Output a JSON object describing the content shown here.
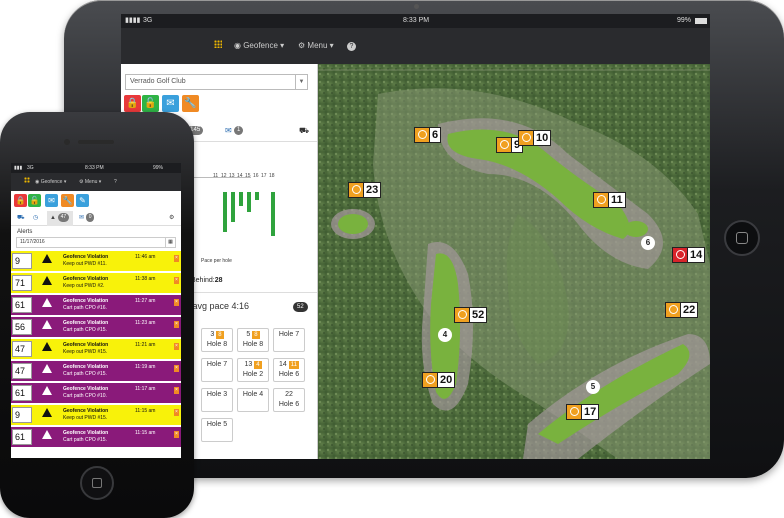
{
  "tablet": {
    "status": {
      "signal": "3G",
      "time": "8:33 PM",
      "battery": "99%"
    },
    "nav": {
      "geofence": "Geofence",
      "menu": "Menu",
      "help": "?"
    },
    "course_select": "Verrado Golf Club",
    "tabs": {
      "alerts_count": "145",
      "messages_count": "1"
    },
    "chart_labels": [
      "11",
      "12",
      "13",
      "14",
      "15",
      "16",
      "17",
      "18"
    ],
    "pace_caption": "Pace per hole",
    "behind_label": "Behind:",
    "behind_value": "28",
    "avg_pace": "- avg pace 4:16",
    "avg_count": "52",
    "holes": [
      {
        "cart": "3",
        "count": "8",
        "hole": "Hole 8"
      },
      {
        "cart": "5",
        "count": "8",
        "hole": "Hole 8"
      },
      {
        "cart": "",
        "count": "",
        "hole": "Hole 7"
      },
      {
        "cart": "",
        "count": "",
        "hole": "Hole 7"
      },
      {
        "cart": "13",
        "count": "4",
        "hole": "Hole 2"
      },
      {
        "cart": "14",
        "count": "11",
        "hole": "Hole 6"
      },
      {
        "cart": "",
        "count": "",
        "hole": "Hole 3"
      },
      {
        "cart": "",
        "count": "",
        "hole": "Hole 4"
      },
      {
        "cart": "22",
        "count": "",
        "hole": "Hole 6"
      },
      {
        "cart": "",
        "count": "",
        "hole": "Hole 5"
      }
    ],
    "map_markers": [
      {
        "label": "6",
        "alert": false
      },
      {
        "label": "9",
        "alert": false
      },
      {
        "label": "10",
        "alert": false
      },
      {
        "label": "23",
        "alert": false
      },
      {
        "label": "11",
        "alert": false
      },
      {
        "label": "14",
        "alert": true
      },
      {
        "label": "52",
        "alert": false
      },
      {
        "label": "22",
        "alert": false
      },
      {
        "label": "20",
        "alert": false
      },
      {
        "label": "17",
        "alert": false
      }
    ],
    "map_dots": [
      "6",
      "4",
      "5"
    ]
  },
  "phone": {
    "status": {
      "signal": "3G",
      "time": "8:33 PM",
      "battery": "99%"
    },
    "nav": {
      "geofence": "Geofence",
      "menu": "Menu",
      "help": "?"
    },
    "tabs": {
      "alerts_count": "47",
      "messages_count": "0"
    },
    "alerts_title": "Alerts",
    "date": "11/17/2016",
    "alerts": [
      {
        "num": "9",
        "title": "Geofence Violation",
        "detail": "Keep out PWD #11.",
        "time": "11:46 am",
        "color": "yel"
      },
      {
        "num": "71",
        "title": "Geofence Violation",
        "detail": "Keep out PWD #2.",
        "time": "11:38 am",
        "color": "yel"
      },
      {
        "num": "61",
        "title": "Geofence Violation",
        "detail": "Cart path CPO #16.",
        "time": "11:27 am",
        "color": "pur"
      },
      {
        "num": "56",
        "title": "Geofence Violation",
        "detail": "Cart path CPO #15.",
        "time": "11:23 am",
        "color": "pur"
      },
      {
        "num": "47",
        "title": "Geofence Violation",
        "detail": "Keep out PWD #15.",
        "time": "11:21 am",
        "color": "yel"
      },
      {
        "num": "47",
        "title": "Geofence Violation",
        "detail": "Cart path CPO #15.",
        "time": "11:19 am",
        "color": "pur"
      },
      {
        "num": "61",
        "title": "Geofence Violation",
        "detail": "Cart path CPO #10.",
        "time": "11:17 am",
        "color": "pur"
      },
      {
        "num": "9",
        "title": "Geofence Violation",
        "detail": "Keep out PWD #15.",
        "time": "11:15 am",
        "color": "yel"
      },
      {
        "num": "61",
        "title": "Geofence Violation",
        "detail": "Cart path CPO #15.",
        "time": "11:15 am",
        "color": "pur"
      }
    ]
  }
}
